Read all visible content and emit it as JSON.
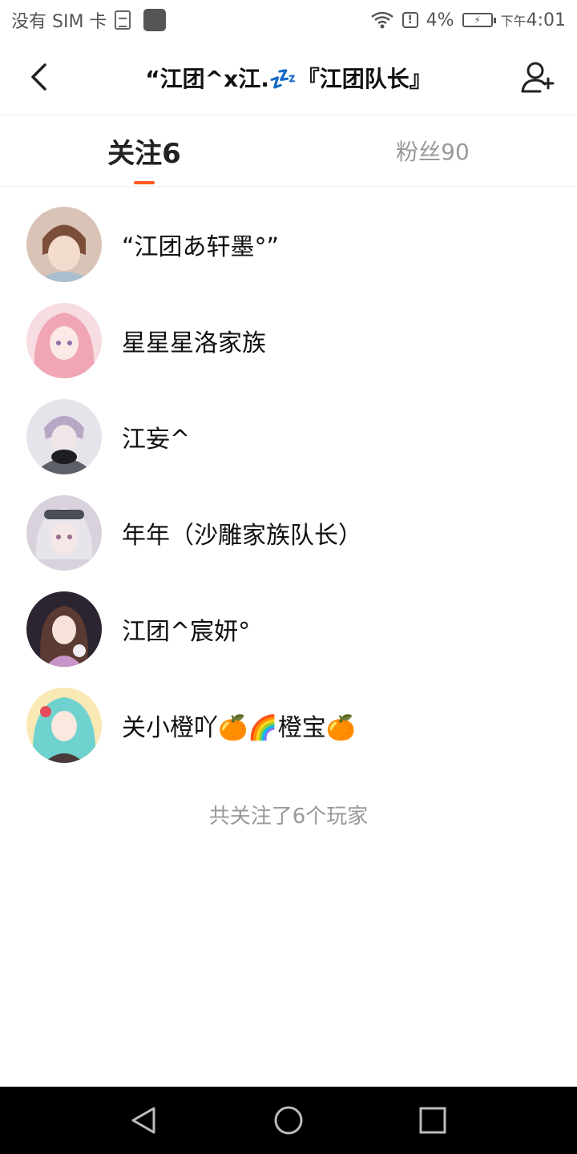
{
  "status_bar": {
    "carrier": "没有 SIM 卡",
    "battery_percent": "4%",
    "time_prefix": "下午",
    "time": "4:01"
  },
  "header": {
    "title": "“江团^x江.💤『江团队长』",
    "back_icon": "chevron-left-icon",
    "add_icon": "add-user-icon"
  },
  "tabs": [
    {
      "label": "关注6",
      "active": true
    },
    {
      "label": "粉丝90",
      "active": false
    }
  ],
  "accent_color": "#ff5a1f",
  "follow_list": [
    {
      "name": "“江团あ轩墨°”",
      "avatar_color": "#b98e7a"
    },
    {
      "name": "星星星洛家族",
      "avatar_color": "#f1b6bf"
    },
    {
      "name": "江妄^",
      "avatar_color": "#8d8c95"
    },
    {
      "name": "年年（沙雕家族队长）",
      "avatar_color": "#c6b9c9"
    },
    {
      "name": "江团^宸妍°",
      "avatar_color": "#6a4b4c"
    },
    {
      "name": "关小橙吖🍊🌈橙宝🍊",
      "avatar_color": "#7fd3cf"
    }
  ],
  "footer_note": "共关注了6个玩家"
}
